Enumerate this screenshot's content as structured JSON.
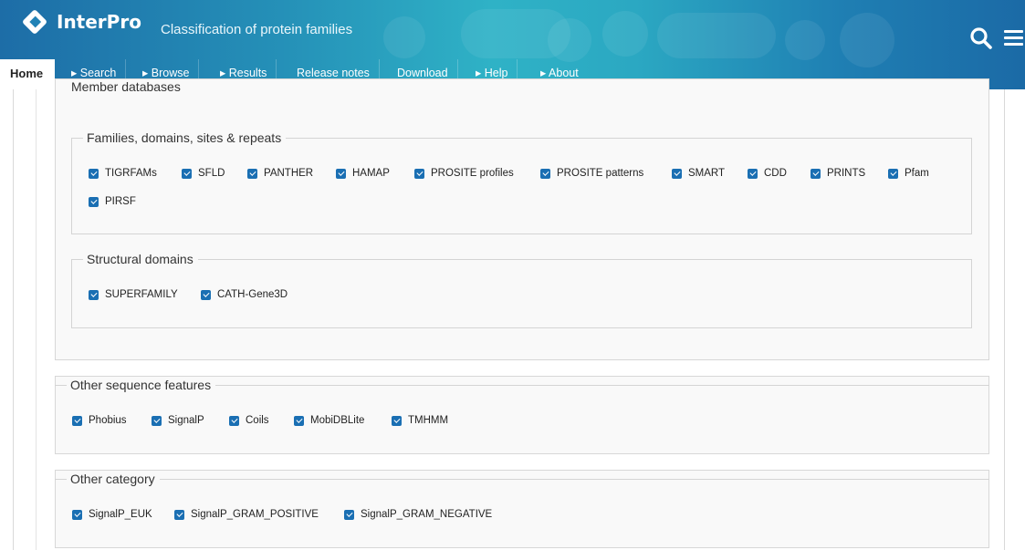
{
  "header": {
    "brand": "InterPro",
    "tagline": "Classification of protein families"
  },
  "nav": {
    "home": "Home",
    "items": [
      "▸ Search",
      "▸ Browse",
      "▸ Results",
      "Release notes",
      "Download",
      "▸ Help",
      "▸ About"
    ]
  },
  "member_databases": {
    "legend": "Member databases",
    "families": {
      "legend": "Families, domains, sites & repeats",
      "items": [
        "TIGRFAMs",
        "SFLD",
        "PANTHER",
        "HAMAP",
        "PROSITE profiles",
        "PROSITE patterns",
        "SMART",
        "CDD",
        "PRINTS",
        "Pfam",
        "PIRSF"
      ],
      "checked": true
    },
    "structural": {
      "legend": "Structural domains",
      "items": [
        "SUPERFAMILY",
        "CATH-Gene3D"
      ],
      "checked": true
    }
  },
  "other_sequence_features": {
    "legend": "Other sequence features",
    "items": [
      "Phobius",
      "SignalP",
      "Coils",
      "MobiDBLite",
      "TMHMM"
    ],
    "checked": true
  },
  "other_category": {
    "legend": "Other category",
    "items": [
      "SignalP_EUK",
      "SignalP_GRAM_POSITIVE",
      "SignalP_GRAM_NEGATIVE"
    ],
    "checked": true
  },
  "colors": {
    "header_blue": "#1d6da7",
    "header_teal": "#2fb2c6",
    "checkbox": "#1a6fb3"
  },
  "icons": [
    "logo-icon",
    "search-icon",
    "menu-icon",
    "checkbox-checked-icon"
  ]
}
